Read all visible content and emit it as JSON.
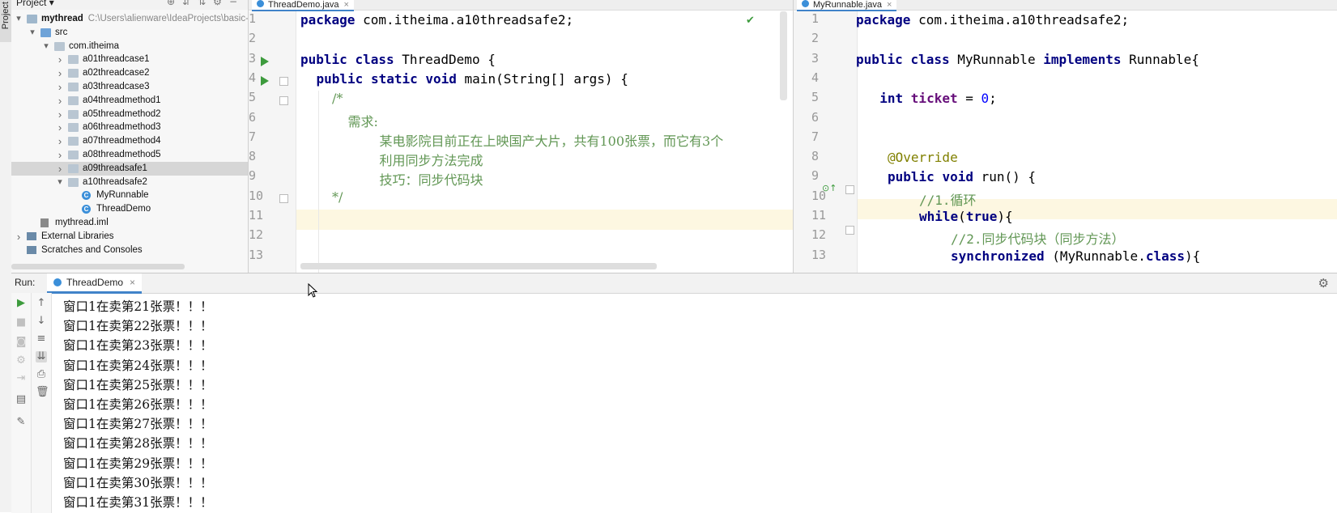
{
  "project_panel": {
    "title": "Project",
    "tree": [
      {
        "label": "mythread",
        "path": "C:\\Users\\alienware\\IdeaProjects\\basic-",
        "depth": 0,
        "expanded": true,
        "icon": "module-folder-icon",
        "bold": true
      },
      {
        "label": "src",
        "depth": 1,
        "expanded": true,
        "icon": "source-folder-icon"
      },
      {
        "label": "com.itheima",
        "depth": 2,
        "expanded": true,
        "icon": "package-icon"
      },
      {
        "label": "a01threadcase1",
        "depth": 3,
        "expanded": false,
        "icon": "package-icon"
      },
      {
        "label": "a02threadcase2",
        "depth": 3,
        "expanded": false,
        "icon": "package-icon"
      },
      {
        "label": "a03threadcase3",
        "depth": 3,
        "expanded": false,
        "icon": "package-icon"
      },
      {
        "label": "a04threadmethod1",
        "depth": 3,
        "expanded": false,
        "icon": "package-icon"
      },
      {
        "label": "a05threadmethod2",
        "depth": 3,
        "expanded": false,
        "icon": "package-icon"
      },
      {
        "label": "a06threadmethod3",
        "depth": 3,
        "expanded": false,
        "icon": "package-icon"
      },
      {
        "label": "a07threadmethod4",
        "depth": 3,
        "expanded": false,
        "icon": "package-icon"
      },
      {
        "label": "a08threadmethod5",
        "depth": 3,
        "expanded": false,
        "icon": "package-icon"
      },
      {
        "label": "a09threadsafe1",
        "depth": 3,
        "expanded": false,
        "icon": "package-icon",
        "selected": true
      },
      {
        "label": "a10threadsafe2",
        "depth": 3,
        "expanded": true,
        "icon": "package-icon"
      },
      {
        "label": "MyRunnable",
        "depth": 4,
        "icon": "class-icon"
      },
      {
        "label": "ThreadDemo",
        "depth": 4,
        "icon": "class-icon"
      },
      {
        "label": "mythread.iml",
        "depth": 1,
        "icon": "iml-file-icon"
      },
      {
        "label": "External Libraries",
        "depth": 0,
        "expanded": false,
        "icon": "libraries-icon"
      },
      {
        "label": "Scratches and Consoles",
        "depth": 0,
        "icon": "scratches-icon"
      }
    ]
  },
  "editor_left": {
    "tab": "ThreadDemo.java",
    "line_numbers": [
      "1",
      "2",
      "3",
      "4",
      "5",
      "6",
      "7",
      "8",
      "9",
      "10",
      "11",
      "12",
      "13"
    ],
    "lines": [
      "package com.itheima.a10threadsafe2;",
      "",
      "public class ThreadDemo {",
      "public static void main(String[] args) {",
      "/*",
      "需求:",
      "某电影院目前正在上映国产大片，共有100张票，而它有3个",
      "利用同步方法完成",
      "技巧：同步代码块",
      "*/",
      "",
      ""
    ]
  },
  "editor_right": {
    "tab": "MyRunnable.java",
    "line_numbers": [
      "1",
      "2",
      "3",
      "4",
      "5",
      "6",
      "7",
      "8",
      "9",
      "10",
      "11",
      "12",
      "13"
    ],
    "lines": [
      "package com.itheima.a10threadsafe2;",
      "",
      "public class MyRunnable implements Runnable{",
      "",
      "int ticket = 0;",
      "",
      "",
      "@Override",
      "public void run() {",
      "//1.循环",
      "while(true){",
      "//2.同步代码块（同步方法）",
      "synchronized (MyRunnable.class){"
    ]
  },
  "run_panel": {
    "label": "Run:",
    "tab": "ThreadDemo",
    "output": [
      "窗口1在卖第21张票！！！",
      "窗口1在卖第22张票！！！",
      "窗口1在卖第23张票！！！",
      "窗口1在卖第24张票！！！",
      "窗口1在卖第25张票！！！",
      "窗口1在卖第26张票！！！",
      "窗口1在卖第27张票！！！",
      "窗口1在卖第28张票！！！",
      "窗口1在卖第29张票！！！",
      "窗口1在卖第30张票！！！",
      "窗口1在卖第31张票！！！"
    ]
  },
  "colors": {
    "keyword": "#000080",
    "comment_text": "#629755",
    "number": "#0000ff",
    "annotation": "#808000",
    "field": "#660e7a",
    "current_line": "#fdf7e1",
    "accent": "#4083c9",
    "run_green": "#3d9b3d"
  }
}
